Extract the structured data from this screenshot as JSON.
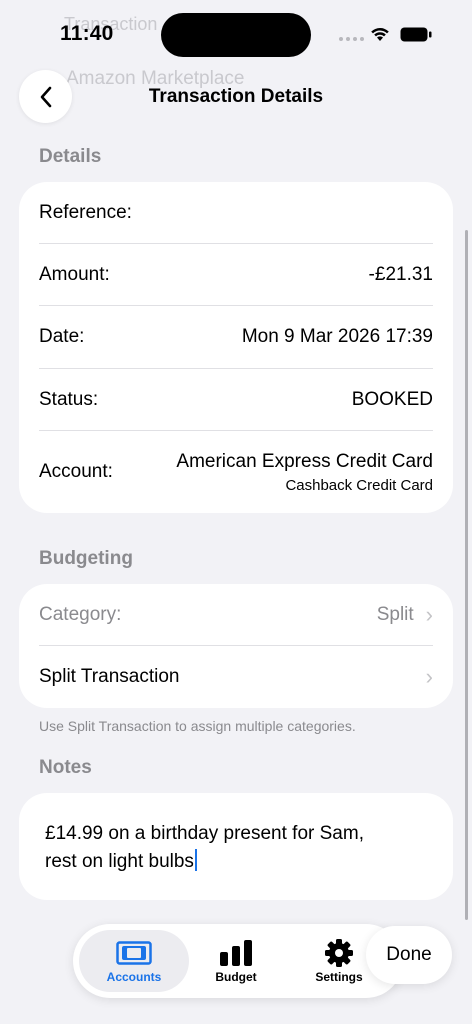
{
  "status_bar": {
    "time": "11:40"
  },
  "background": {
    "faded_line1": "Transaction",
    "faded_line2": "Amazon Marketplace"
  },
  "nav": {
    "title": "Transaction Details",
    "back_icon": "chevron-left-icon"
  },
  "details": {
    "header": "Details",
    "rows": [
      {
        "label": "Reference:",
        "value": ""
      },
      {
        "label": "Amount:",
        "value": "-£21.31"
      },
      {
        "label": "Date:",
        "value": "Mon 9 Mar 2026 17:39"
      },
      {
        "label": "Status:",
        "value": "BOOKED"
      },
      {
        "label": "Account:",
        "value": "American Express Credit Card",
        "subvalue": "Cashback Credit Card"
      }
    ]
  },
  "budgeting": {
    "header": "Budgeting",
    "category_label": "Category:",
    "category_value": "Split",
    "split_label": "Split Transaction",
    "footnote": "Use Split Transaction to assign multiple categories."
  },
  "notes": {
    "header": "Notes",
    "line1": "£14.99 on a birthday present for Sam,",
    "line2": "rest on light bulbs"
  },
  "tabbar": {
    "tabs": [
      {
        "label": "Accounts",
        "icon": "card-icon",
        "selected": true
      },
      {
        "label": "Budget",
        "icon": "bar-chart-icon",
        "selected": false
      },
      {
        "label": "Settings",
        "icon": "gear-icon",
        "selected": false
      }
    ],
    "done_label": "Done"
  },
  "colors": {
    "accent": "#1a73e8",
    "background": "#f2f2f6",
    "secondary_text": "#8a8a8e"
  }
}
